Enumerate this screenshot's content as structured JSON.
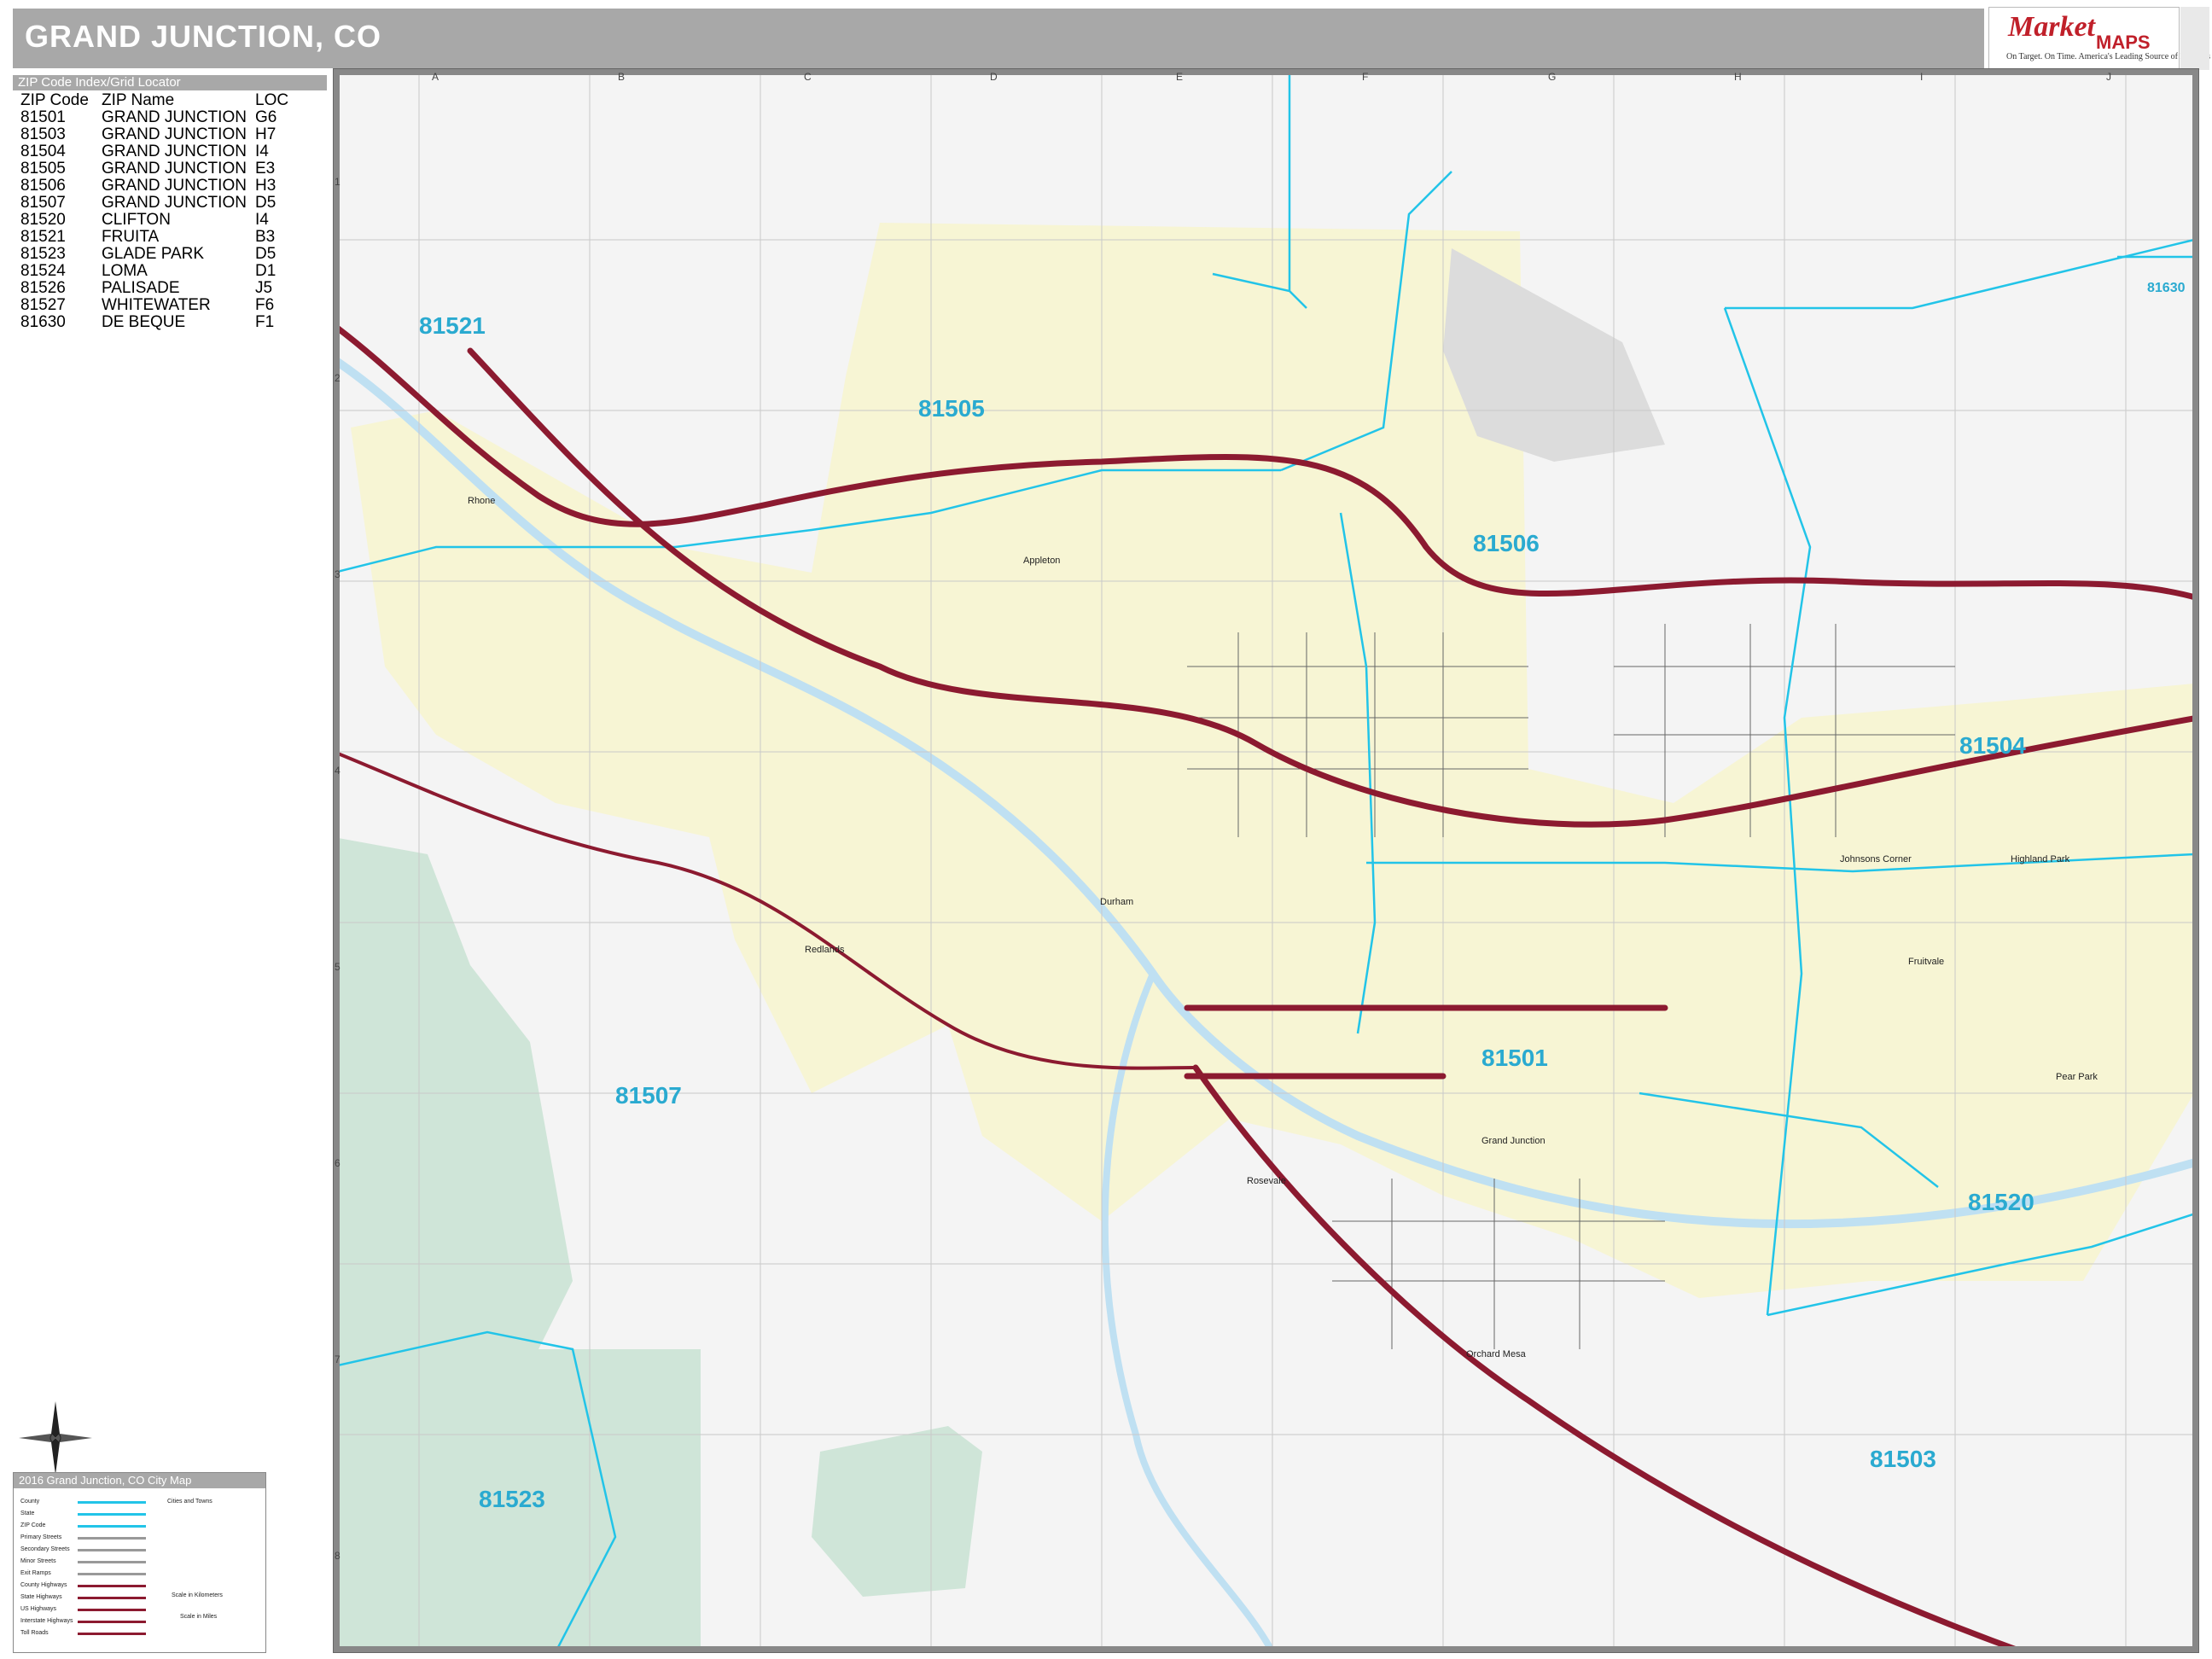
{
  "title": "GRAND JUNCTION, CO",
  "logo": {
    "word1": "Market",
    "word2": "MAPS",
    "tagline": "On Target. On Time.  America's Leading Source of Business Maps"
  },
  "index": {
    "header": "ZIP Code Index/Grid Locator",
    "columns": [
      "ZIP Code",
      "ZIP Name",
      "LOC"
    ],
    "rows": [
      [
        "81501",
        "GRAND JUNCTION",
        "G6"
      ],
      [
        "81503",
        "GRAND JUNCTION",
        "H7"
      ],
      [
        "81504",
        "GRAND JUNCTION",
        "I4"
      ],
      [
        "81505",
        "GRAND JUNCTION",
        "E3"
      ],
      [
        "81506",
        "GRAND JUNCTION",
        "H3"
      ],
      [
        "81507",
        "GRAND JUNCTION",
        "D5"
      ],
      [
        "81520",
        "CLIFTON",
        "I4"
      ],
      [
        "81521",
        "FRUITA",
        "B3"
      ],
      [
        "81523",
        "GLADE PARK",
        "D5"
      ],
      [
        "81524",
        "LOMA",
        "D1"
      ],
      [
        "81526",
        "PALISADE",
        "J5"
      ],
      [
        "81527",
        "WHITEWATER",
        "F6"
      ],
      [
        "81630",
        "DE BEQUE",
        "F1"
      ]
    ]
  },
  "grid": {
    "letters": [
      "A",
      "B",
      "C",
      "D",
      "E",
      "F",
      "G",
      "H",
      "I",
      "J"
    ],
    "numbers": [
      "1",
      "2",
      "3",
      "4",
      "5",
      "6",
      "7",
      "8"
    ]
  },
  "zip_labels": [
    "81521",
    "81505",
    "81506",
    "81504",
    "81501",
    "81507",
    "81520",
    "81503",
    "81523",
    "81630"
  ],
  "places": [
    "Rhone",
    "Appleton",
    "Durham",
    "Redlands",
    "Grand Junction",
    "Rosevale",
    "Orchard Mesa",
    "Fruitvale",
    "Pear Park",
    "Johnsons Corner",
    "Highland Park"
  ],
  "legend": {
    "title": "2016 Grand Junction, CO City Map",
    "items": [
      "County",
      "State",
      "ZIP Code",
      "Primary Streets",
      "Secondary Streets",
      "Minor Streets",
      "Exit Ramps",
      "County Highways",
      "State Highways",
      "US Highways",
      "Interstate Highways",
      "Toll Roads"
    ],
    "cities_title": "Cities and Towns",
    "scale_km": "Scale in Kilometers",
    "scale_mi": "Scale in Miles"
  },
  "colors": {
    "zip_border": "#22c4e8",
    "highway": "#8c1a30",
    "urban": "#f7f5d4",
    "park": "#cfe5d8",
    "water": "#cfe6f5"
  }
}
